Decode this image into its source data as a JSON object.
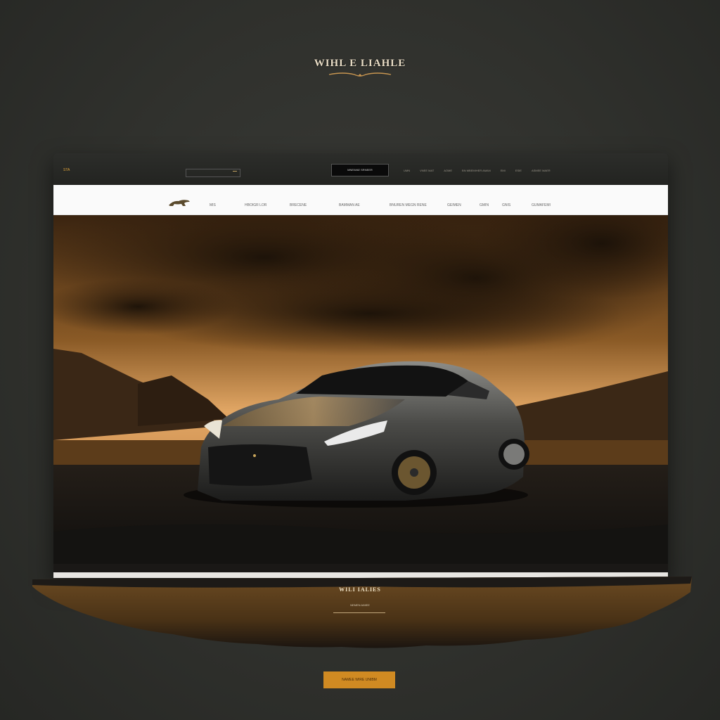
{
  "brand": {
    "title": "WIHL E LIAHLE"
  },
  "topbar": {
    "left_label": "STA",
    "search_placeholder": "",
    "center_label": "MNEWAE SRNEER",
    "links": [
      "UMN",
      "VNEE MAT",
      "AOME",
      "BN MBEMIHER AMAN",
      "EMI",
      "ESIE",
      "ASMEE MAER"
    ]
  },
  "nav": {
    "items": [
      "MIS",
      "HBOIGR LOR",
      "BRECENE",
      "BAMMAN AE",
      "BNUREN MEGN RENE",
      "GEIMEN",
      "GMIN",
      "GNIS",
      "GUMAFEMI"
    ]
  },
  "footer_section": {
    "title": "WILI IALIES",
    "subtitle": "NEMEN AIMEE"
  },
  "cta": {
    "label": "NAMEE WIRE UNIBM"
  },
  "colors": {
    "accent": "#d08a22",
    "background": "#30312d",
    "gold": "#c7a15a"
  }
}
